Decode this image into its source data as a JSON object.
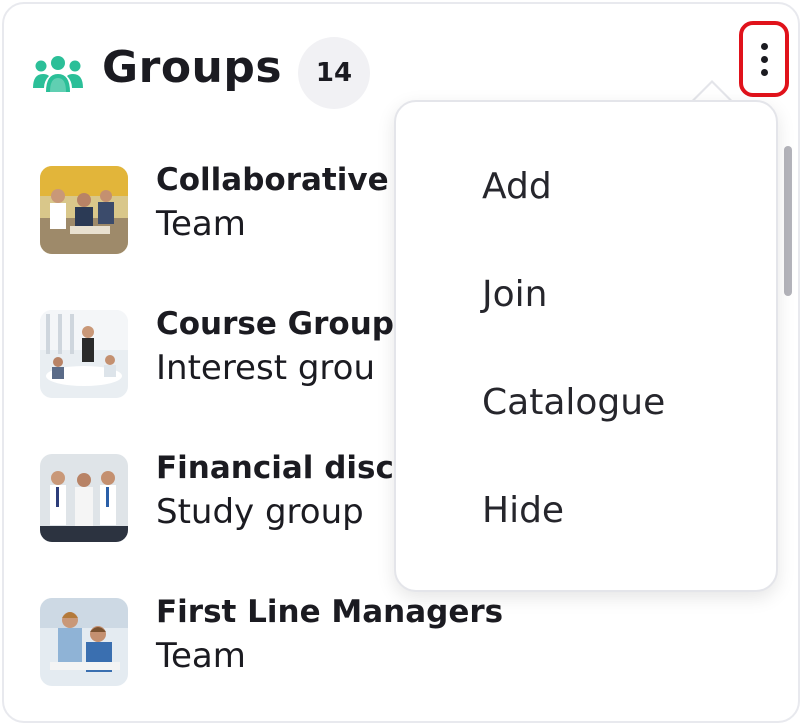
{
  "header": {
    "icon": "people-group-icon",
    "title": "Groups",
    "count": "14",
    "more_icon": "vertical-dots-icon"
  },
  "groups": [
    {
      "name": "Collaborative",
      "type": "Team"
    },
    {
      "name": "Course Group",
      "type": "Interest grou"
    },
    {
      "name": "Financial disc",
      "type": "Study group"
    },
    {
      "name": "First Line Managers",
      "type": "Team"
    }
  ],
  "menu": {
    "items": [
      "Add",
      "Join",
      "Catalogue",
      "Hide"
    ]
  },
  "colors": {
    "accent": "#2bbf98",
    "highlight": "#e0121b"
  }
}
